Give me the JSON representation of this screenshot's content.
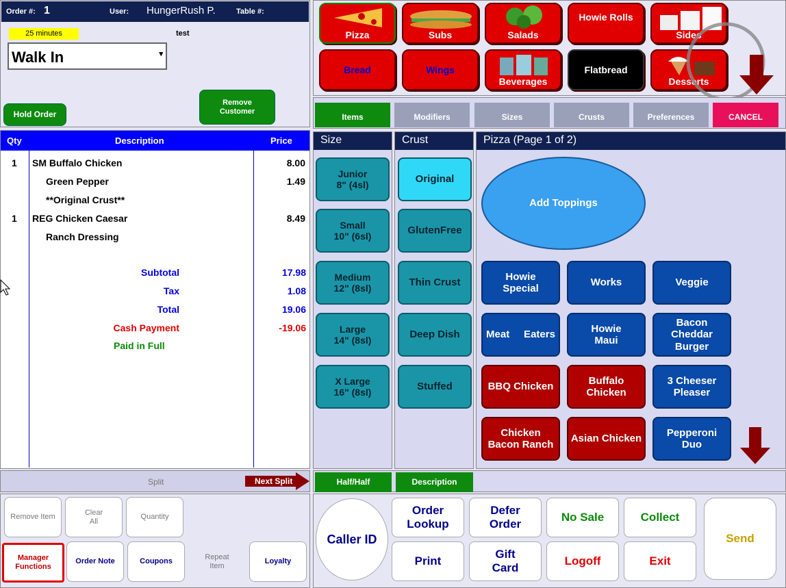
{
  "header": {
    "order_label": "Order #:",
    "order_number": "1",
    "user_label": "User:",
    "user_name": "HungerRush P.",
    "table_label": "Table #:",
    "time_badge": "25 minutes",
    "note": "test",
    "order_type": "Walk In"
  },
  "left_buttons": {
    "hold": "Hold Order",
    "remove_customer": "Remove\nCustomer"
  },
  "order_table": {
    "headers": [
      "Qty",
      "Description",
      "Price"
    ],
    "rows": [
      {
        "qty": "1",
        "desc": "SM  Buffalo Chicken",
        "price": "8.00"
      },
      {
        "qty": "",
        "desc": "Green Pepper",
        "price": "1.49"
      },
      {
        "qty": "",
        "desc": "**Original Crust**",
        "price": ""
      },
      {
        "qty": "1",
        "desc": "REG Chicken Caesar",
        "price": "8.49"
      },
      {
        "qty": "",
        "desc": "Ranch Dressing",
        "price": ""
      }
    ],
    "subtotal_label": "Subtotal",
    "subtotal": "17.98",
    "tax_label": "Tax",
    "tax": "1.08",
    "total_label": "Total",
    "total": "19.06",
    "payment_label": "Cash Payment",
    "payment": "-19.06",
    "paid_label": "Paid in Full"
  },
  "split": {
    "label": "Split",
    "next": "Next Split"
  },
  "bottom_left": {
    "remove_item": "Remove Item",
    "clear_all": "Clear\nAll",
    "quantity": "Quantity",
    "manager": "Manager\nFunctions",
    "order_note": "Order Note",
    "coupons": "Coupons",
    "repeat_item": "Repeat\nItem",
    "loyalty": "Loyalty"
  },
  "categories": {
    "pizza": "Pizza",
    "subs": "Subs",
    "salads": "Salads",
    "howie_rolls": "Howie Rolls",
    "sides": "Sides",
    "bread": "Bread",
    "wings": "Wings",
    "beverages": "Beverages",
    "flatbread": "Flatbread",
    "desserts": "Desserts"
  },
  "tabs": {
    "items": "Items",
    "modifiers": "Modifiers",
    "sizes": "Sizes",
    "crusts": "Crusts",
    "preferences": "Preferences",
    "cancel": "CANCEL"
  },
  "size": {
    "title": "Size",
    "items": [
      "Junior\n8\" (4sl)",
      "Small\n10\" (6sl)",
      "Medium\n12\" (8sl)",
      "Large\n14\" (8sl)",
      "X Large\n16\" (8sl)"
    ]
  },
  "crust": {
    "title": "Crust",
    "items": [
      "Original",
      "GlutenFree",
      "Thin Crust",
      "Deep Dish",
      "Stuffed"
    ]
  },
  "pizza": {
    "title": "Pizza  (Page 1 of 2)",
    "add_toppings": "Add Toppings",
    "items": [
      "Howie\nSpecial",
      "Works",
      "Veggie",
      "Meat     Eaters",
      "Howie\nMaui",
      "Bacon\nCheddar\nBurger",
      "BBQ Chicken",
      "Buffalo\nChicken",
      "3 Cheeser\nPleaser",
      "Chicken\nBacon Ranch",
      "Asian Chicken",
      "Pepperoni\nDuo"
    ]
  },
  "lower_tabs": {
    "half": "Half/Half",
    "description": "Description"
  },
  "actions": {
    "caller_id": "Caller ID",
    "order_lookup": "Order\nLookup",
    "defer_order": "Defer\nOrder",
    "no_sale": "No Sale",
    "collect": "Collect",
    "send": "Send",
    "print": "Print",
    "gift_card": "Gift\nCard",
    "logoff": "Logoff",
    "exit": "Exit"
  }
}
